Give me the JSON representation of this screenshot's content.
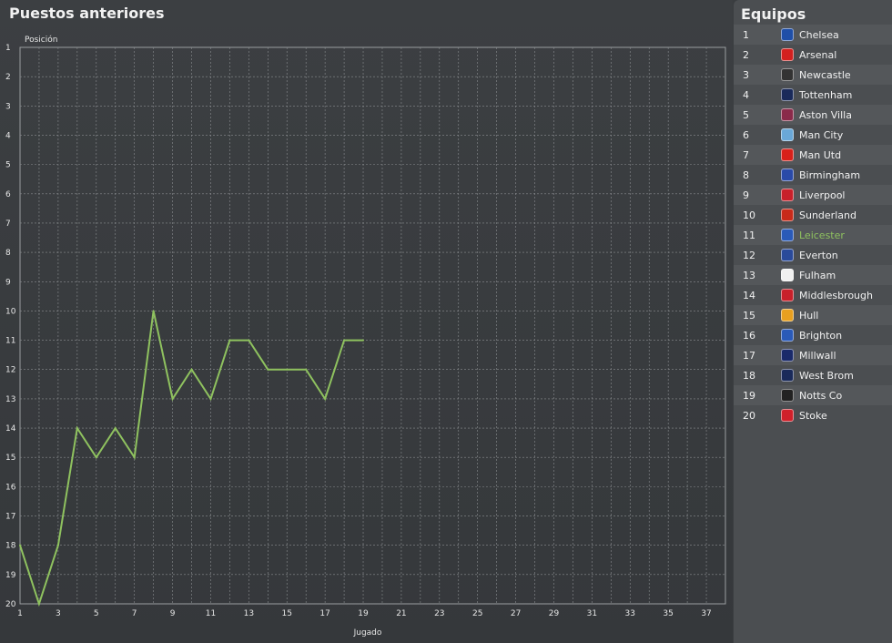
{
  "panel_title": "Puestos anteriores",
  "chart_data": {
    "type": "line",
    "xlabel": "Jugado",
    "ylabel": "Posición",
    "xlim": [
      1,
      38
    ],
    "ylim": [
      1,
      20
    ],
    "y_inverted": true,
    "grid": true,
    "x_ticks": [
      1,
      3,
      5,
      7,
      9,
      11,
      13,
      15,
      17,
      19,
      21,
      23,
      25,
      27,
      29,
      31,
      33,
      35,
      37
    ],
    "y_ticks": [
      1,
      2,
      3,
      4,
      5,
      6,
      7,
      8,
      9,
      10,
      11,
      12,
      13,
      14,
      15,
      16,
      17,
      18,
      19,
      20
    ],
    "series": [
      {
        "color": "#8fc25f",
        "x": [
          1,
          2,
          3,
          4,
          5,
          6,
          7,
          8,
          9,
          10,
          11,
          12,
          13,
          14,
          15,
          16,
          17,
          18,
          19
        ],
        "values": [
          18,
          20,
          18,
          14,
          15,
          14,
          15,
          10,
          13,
          12,
          13,
          11,
          11,
          12,
          12,
          12,
          13,
          11,
          11
        ]
      }
    ]
  },
  "teams_panel": {
    "title": "Equipos",
    "highlight_color": "#8fc25f",
    "teams": [
      {
        "pos": "1",
        "name": "Chelsea",
        "badge": "chelsea-badge-icon",
        "color": "#1f4fa8"
      },
      {
        "pos": "2",
        "name": "Arsenal",
        "badge": "arsenal-badge-icon",
        "color": "#d3201f"
      },
      {
        "pos": "3",
        "name": "Newcastle",
        "badge": "newcastle-badge-icon",
        "color": "#333333"
      },
      {
        "pos": "4",
        "name": "Tottenham",
        "badge": "tottenham-badge-icon",
        "color": "#1a2a5a"
      },
      {
        "pos": "5",
        "name": "Aston Villa",
        "badge": "aston-villa-badge-icon",
        "color": "#8a2a4a"
      },
      {
        "pos": "6",
        "name": "Man City",
        "badge": "man-city-badge-icon",
        "color": "#6aa8d8"
      },
      {
        "pos": "7",
        "name": "Man Utd",
        "badge": "man-utd-badge-icon",
        "color": "#d8201a"
      },
      {
        "pos": "8",
        "name": "Birmingham",
        "badge": "birmingham-badge-icon",
        "color": "#2a4aa8"
      },
      {
        "pos": "9",
        "name": "Liverpool",
        "badge": "liverpool-badge-icon",
        "color": "#c8202a"
      },
      {
        "pos": "10",
        "name": "Sunderland",
        "badge": "sunderland-badge-icon",
        "color": "#c82a1a"
      },
      {
        "pos": "11",
        "name": "Leicester",
        "badge": "leicester-badge-icon",
        "color": "#2a5ab8",
        "highlight": true
      },
      {
        "pos": "12",
        "name": "Everton",
        "badge": "everton-badge-icon",
        "color": "#2a4a9a"
      },
      {
        "pos": "13",
        "name": "Fulham",
        "badge": "fulham-badge-icon",
        "color": "#f0f0f0"
      },
      {
        "pos": "14",
        "name": "Middlesbrough",
        "badge": "middlesbrough-badge-icon",
        "color": "#c8202a"
      },
      {
        "pos": "15",
        "name": "Hull",
        "badge": "hull-badge-icon",
        "color": "#e8a020"
      },
      {
        "pos": "16",
        "name": "Brighton",
        "badge": "brighton-badge-icon",
        "color": "#2a5ab8"
      },
      {
        "pos": "17",
        "name": "Millwall",
        "badge": "millwall-badge-icon",
        "color": "#1a2a6a"
      },
      {
        "pos": "18",
        "name": "West Brom",
        "badge": "west-brom-badge-icon",
        "color": "#1a2a5a"
      },
      {
        "pos": "19",
        "name": "Notts Co",
        "badge": "notts-co-badge-icon",
        "color": "#222222"
      },
      {
        "pos": "20",
        "name": "Stoke",
        "badge": "stoke-badge-icon",
        "color": "#d0202a"
      }
    ]
  }
}
